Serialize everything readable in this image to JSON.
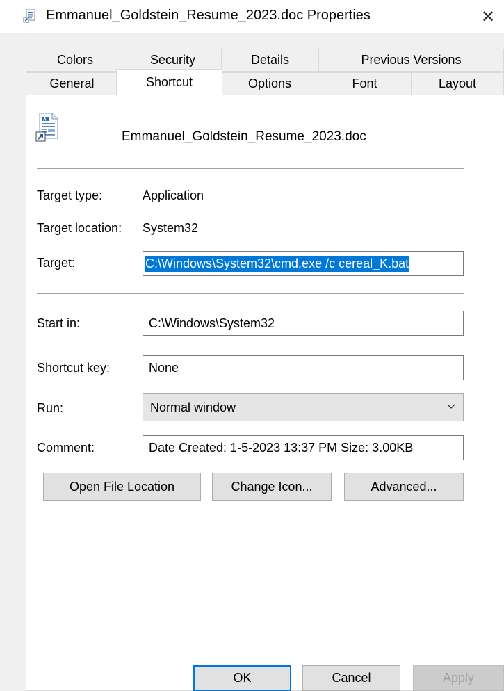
{
  "window": {
    "title": "Emmanuel_Goldstein_Resume_2023.doc Properties",
    "close_glyph": "✕"
  },
  "tabs_row1": [
    {
      "label": "Colors"
    },
    {
      "label": "Security"
    },
    {
      "label": "Details"
    },
    {
      "label": "Previous Versions"
    }
  ],
  "tabs_row2": [
    {
      "label": "General"
    },
    {
      "label": "Shortcut",
      "active": true
    },
    {
      "label": "Options"
    },
    {
      "label": "Font"
    },
    {
      "label": "Layout"
    }
  ],
  "shortcut": {
    "file_name": "Emmanuel_Goldstein_Resume_2023.doc",
    "target_type_label": "Target type:",
    "target_type_value": "Application",
    "target_location_label": "Target location:",
    "target_location_value": "System32",
    "target_label": "Target:",
    "target_value": "C:\\Windows\\System32\\cmd.exe /c cereal_K.bat",
    "start_in_label": "Start in:",
    "start_in_value": "C:\\Windows\\System32",
    "shortcut_key_label": "Shortcut key:",
    "shortcut_key_value": "None",
    "run_label": "Run:",
    "run_value": "Normal window",
    "comment_label": "Comment:",
    "comment_value": "Date Created: 1-5-2023 13:37 PM Size: 3.00KB",
    "open_file_location": "Open File Location",
    "change_icon": "Change Icon...",
    "advanced": "Advanced..."
  },
  "footer": {
    "ok": "OK",
    "cancel": "Cancel",
    "apply": "Apply"
  },
  "colors": {
    "selection": "#0078d7",
    "panel": "#ffffff",
    "dialog": "#f0f0f0"
  }
}
